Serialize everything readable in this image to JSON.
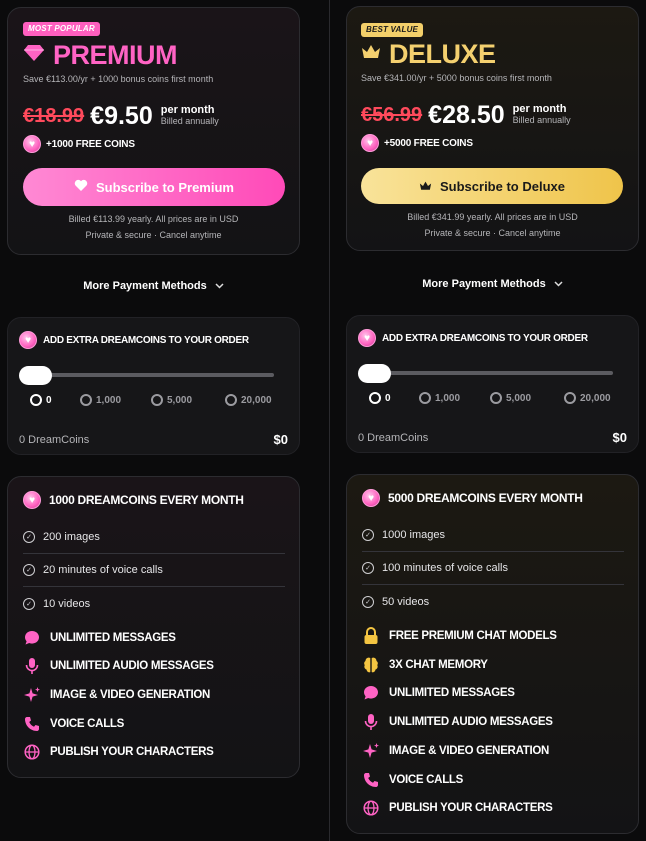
{
  "plans": [
    {
      "key": "premium",
      "badge": "MOST POPULAR",
      "name": "PREMIUM",
      "icon": "diamond-icon",
      "subtitle": "Save €113.00/yr + 1000 bonus coins first month",
      "old_price": "€18.99",
      "new_price": "€9.50",
      "per_month": "per month",
      "billed_annually": "Billed annually",
      "free_coins": "+1000 FREE COINS",
      "button_label": "Subscribe to Premium",
      "billed_note": "Billed €113.99 yearly. All prices are in USD",
      "secure_note": "Private & secure · Cancel anytime",
      "accent": "#ff63c4",
      "more_payment": "More Payment Methods",
      "extra": {
        "title": "ADD EXTRA DREAMCOINS TO YOUR ORDER",
        "stops": [
          "0",
          "1,000",
          "5,000",
          "20,000"
        ],
        "selected_stop": "0",
        "summary_left": "0 DreamCoins",
        "summary_right": "$0"
      },
      "features": {
        "title": "1000 DREAMCOINS EVERY MONTH",
        "items": [
          "200 images",
          "20 minutes of voice calls",
          "10 videos"
        ],
        "perks": [
          {
            "icon": "chat-bubble-icon",
            "label": "UNLIMITED MESSAGES"
          },
          {
            "icon": "microphone-icon",
            "label": "UNLIMITED AUDIO MESSAGES"
          },
          {
            "icon": "sparkles-icon",
            "label": "IMAGE & VIDEO GENERATION"
          },
          {
            "icon": "phone-icon",
            "label": "VOICE CALLS"
          },
          {
            "icon": "globe-icon",
            "label": "PUBLISH YOUR CHARACTERS"
          }
        ]
      }
    },
    {
      "key": "deluxe",
      "badge": "BEST VALUE",
      "name": "DELUXE",
      "icon": "crown-icon",
      "subtitle": "Save €341.00/yr + 5000 bonus coins first month",
      "old_price": "€56.99",
      "new_price": "€28.50",
      "per_month": "per month",
      "billed_annually": "Billed annually",
      "free_coins": "+5000 FREE COINS",
      "button_label": "Subscribe to Deluxe",
      "billed_note": "Billed €341.99 yearly. All prices are in USD",
      "secure_note": "Private & secure · Cancel anytime",
      "accent": "#f4d06f",
      "more_payment": "More Payment Methods",
      "extra": {
        "title": "ADD EXTRA DREAMCOINS TO YOUR ORDER",
        "stops": [
          "0",
          "1,000",
          "5,000",
          "20,000"
        ],
        "selected_stop": "0",
        "summary_left": "0 DreamCoins",
        "summary_right": "$0"
      },
      "features": {
        "title": "5000 DREAMCOINS EVERY MONTH",
        "items": [
          "1000 images",
          "100 minutes of voice calls",
          "50 videos"
        ],
        "perks": [
          {
            "icon": "lock-icon",
            "label": "FREE PREMIUM CHAT MODELS"
          },
          {
            "icon": "brain-icon",
            "label": "3X CHAT MEMORY"
          },
          {
            "icon": "chat-bubble-icon",
            "label": "UNLIMITED MESSAGES"
          },
          {
            "icon": "microphone-icon",
            "label": "UNLIMITED AUDIO MESSAGES"
          },
          {
            "icon": "sparkles-icon",
            "label": "IMAGE & VIDEO GENERATION"
          },
          {
            "icon": "phone-icon",
            "label": "VOICE CALLS"
          },
          {
            "icon": "globe-icon",
            "label": "PUBLISH YOUR CHARACTERS"
          }
        ]
      }
    }
  ]
}
